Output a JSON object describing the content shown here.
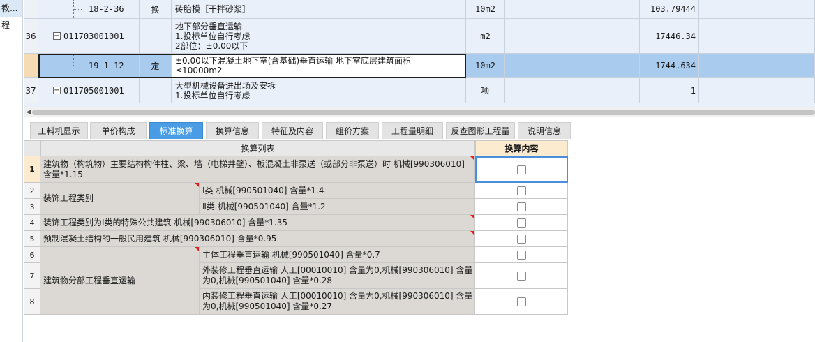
{
  "left_nav": [
    {
      "label": "教..."
    },
    {
      "label": "程"
    }
  ],
  "upper_rows": [
    {
      "num": "",
      "code": "18-2-36",
      "type": "换",
      "name": [
        "砖胎模［干拌砂浆］"
      ],
      "unit": "10m2",
      "qty": "103.79444"
    },
    {
      "num": "36",
      "code": "011703001001",
      "type": "",
      "name": [
        "地下部分垂直运输",
        "1.投标单位自行考虑",
        "2部位：±0.00以下"
      ],
      "unit": "m2",
      "qty": "17446.34"
    },
    {
      "num": "",
      "code": "19-1-12",
      "type": "定",
      "name": [
        "±0.00以下混凝土地下室(含基础)垂直运输 地下室底层建筑面积",
        "≤10000m2"
      ],
      "unit": "10m2",
      "qty": "1744.634"
    },
    {
      "num": "37",
      "code": "011705001001",
      "type": "",
      "name": [
        "大型机械设备进出场及安拆",
        "1.投标单位自行考虑"
      ],
      "unit": "项",
      "qty": "1"
    }
  ],
  "tabs": [
    {
      "label": "工料机显示"
    },
    {
      "label": "单价构成"
    },
    {
      "label": "标准换算"
    },
    {
      "label": "换算信息"
    },
    {
      "label": "特征及内容"
    },
    {
      "label": "组价方案"
    },
    {
      "label": "工程量明细"
    },
    {
      "label": "反查图形工程量"
    },
    {
      "label": "说明信息"
    }
  ],
  "lower": {
    "header_list": "换算列表",
    "header_content": "换算内容",
    "rows": [
      {
        "idx": "1"
      },
      {
        "idx": "2"
      },
      {
        "idx": "3"
      },
      {
        "idx": "4"
      },
      {
        "idx": "5"
      },
      {
        "idx": "6"
      },
      {
        "idx": "7"
      },
      {
        "idx": "8"
      }
    ],
    "r1": "建筑物（构筑物）主要结构构件柱、梁、墙（电梯井壁）、板混凝土非泵送（或部分非泵送）时 机械[990306010] 含量*1.15",
    "g_decoration": "装饰工程类别",
    "r2": "Ⅰ类 机械[990501040] 含量*1.4",
    "r3": "Ⅱ类 机械[990501040] 含量*1.2",
    "r4": "装饰工程类别为Ⅰ类的特殊公共建筑 机械[990306010] 含量*1.35",
    "r5": "预制混凝土结构的一般民用建筑 机械[990306010] 含量*0.95",
    "g_vertical": "建筑物分部工程垂直运输",
    "r6": "主体工程垂直运输 机械[990501040] 含量*0.7",
    "r7": "外装修工程垂直运输 人工[00010010] 含量为0,机械[990306010] 含量为0,机械[990501040] 含量*0.28",
    "r8": "内装修工程垂直运输 人工[00010010] 含量为0,机械[990306010] 含量为0,机械[990501040] 含量*0.27"
  },
  "colors": {
    "active_tab": "#4a9de4",
    "selected_row": "#a9cbee",
    "content_header": "#fdebd0",
    "gray_cell": "#dcd9d5"
  }
}
